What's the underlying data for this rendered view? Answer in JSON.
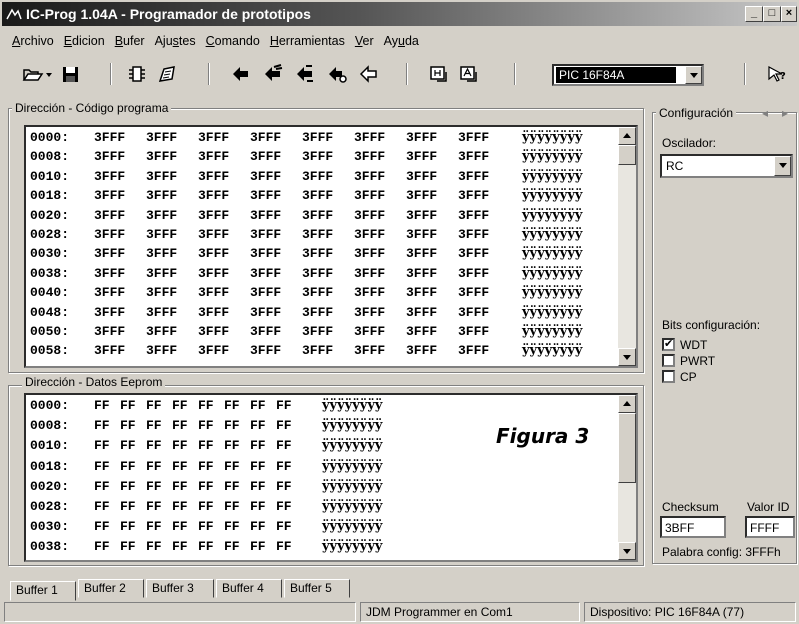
{
  "window": {
    "title": "IC-Prog 1.04A - Programador de prototipos",
    "buttons": {
      "minimize": "_",
      "maximize": "□",
      "close": "×"
    }
  },
  "menu": [
    {
      "label": "Archivo",
      "accel": "A"
    },
    {
      "label": "Edicion",
      "accel": "E"
    },
    {
      "label": "Bufer",
      "accel": "B"
    },
    {
      "label": "Ajustes",
      "accel": "s"
    },
    {
      "label": "Comando",
      "accel": "C"
    },
    {
      "label": "Herramientas",
      "accel": "H"
    },
    {
      "label": "Ver",
      "accel": "V"
    },
    {
      "label": "Ayuda",
      "accel": "u"
    }
  ],
  "toolbar": {
    "icons": [
      "open-icon",
      "dropdown-arrow-icon",
      "save-icon",
      "chip-icon",
      "chip-config-icon",
      "read-icon",
      "write-icon",
      "erase-icon",
      "verify-icon",
      "blank-check-icon",
      "view-hex-icon",
      "view-ascii-icon",
      "help-icon"
    ],
    "device": "PIC 16F84A"
  },
  "program": {
    "label": "Dirección - Código programa",
    "rows": [
      {
        "addr": "0000:",
        "words": [
          "3FFF",
          "3FFF",
          "3FFF",
          "3FFF",
          "3FFF",
          "3FFF",
          "3FFF",
          "3FFF"
        ],
        "ascii": "ÿÿÿÿÿÿÿÿ"
      },
      {
        "addr": "0008:",
        "words": [
          "3FFF",
          "3FFF",
          "3FFF",
          "3FFF",
          "3FFF",
          "3FFF",
          "3FFF",
          "3FFF"
        ],
        "ascii": "ÿÿÿÿÿÿÿÿ"
      },
      {
        "addr": "0010:",
        "words": [
          "3FFF",
          "3FFF",
          "3FFF",
          "3FFF",
          "3FFF",
          "3FFF",
          "3FFF",
          "3FFF"
        ],
        "ascii": "ÿÿÿÿÿÿÿÿ"
      },
      {
        "addr": "0018:",
        "words": [
          "3FFF",
          "3FFF",
          "3FFF",
          "3FFF",
          "3FFF",
          "3FFF",
          "3FFF",
          "3FFF"
        ],
        "ascii": "ÿÿÿÿÿÿÿÿ"
      },
      {
        "addr": "0020:",
        "words": [
          "3FFF",
          "3FFF",
          "3FFF",
          "3FFF",
          "3FFF",
          "3FFF",
          "3FFF",
          "3FFF"
        ],
        "ascii": "ÿÿÿÿÿÿÿÿ"
      },
      {
        "addr": "0028:",
        "words": [
          "3FFF",
          "3FFF",
          "3FFF",
          "3FFF",
          "3FFF",
          "3FFF",
          "3FFF",
          "3FFF"
        ],
        "ascii": "ÿÿÿÿÿÿÿÿ"
      },
      {
        "addr": "0030:",
        "words": [
          "3FFF",
          "3FFF",
          "3FFF",
          "3FFF",
          "3FFF",
          "3FFF",
          "3FFF",
          "3FFF"
        ],
        "ascii": "ÿÿÿÿÿÿÿÿ"
      },
      {
        "addr": "0038:",
        "words": [
          "3FFF",
          "3FFF",
          "3FFF",
          "3FFF",
          "3FFF",
          "3FFF",
          "3FFF",
          "3FFF"
        ],
        "ascii": "ÿÿÿÿÿÿÿÿ"
      },
      {
        "addr": "0040:",
        "words": [
          "3FFF",
          "3FFF",
          "3FFF",
          "3FFF",
          "3FFF",
          "3FFF",
          "3FFF",
          "3FFF"
        ],
        "ascii": "ÿÿÿÿÿÿÿÿ"
      },
      {
        "addr": "0048:",
        "words": [
          "3FFF",
          "3FFF",
          "3FFF",
          "3FFF",
          "3FFF",
          "3FFF",
          "3FFF",
          "3FFF"
        ],
        "ascii": "ÿÿÿÿÿÿÿÿ"
      },
      {
        "addr": "0050:",
        "words": [
          "3FFF",
          "3FFF",
          "3FFF",
          "3FFF",
          "3FFF",
          "3FFF",
          "3FFF",
          "3FFF"
        ],
        "ascii": "ÿÿÿÿÿÿÿÿ"
      },
      {
        "addr": "0058:",
        "words": [
          "3FFF",
          "3FFF",
          "3FFF",
          "3FFF",
          "3FFF",
          "3FFF",
          "3FFF",
          "3FFF"
        ],
        "ascii": "ÿÿÿÿÿÿÿÿ"
      }
    ]
  },
  "eeprom": {
    "label": "Dirección - Datos Eeprom",
    "rows": [
      {
        "addr": "0000:",
        "bytes": [
          "FF",
          "FF",
          "FF",
          "FF",
          "FF",
          "FF",
          "FF",
          "FF"
        ],
        "ascii": "ÿÿÿÿÿÿÿÿ"
      },
      {
        "addr": "0008:",
        "bytes": [
          "FF",
          "FF",
          "FF",
          "FF",
          "FF",
          "FF",
          "FF",
          "FF"
        ],
        "ascii": "ÿÿÿÿÿÿÿÿ"
      },
      {
        "addr": "0010:",
        "bytes": [
          "FF",
          "FF",
          "FF",
          "FF",
          "FF",
          "FF",
          "FF",
          "FF"
        ],
        "ascii": "ÿÿÿÿÿÿÿÿ"
      },
      {
        "addr": "0018:",
        "bytes": [
          "FF",
          "FF",
          "FF",
          "FF",
          "FF",
          "FF",
          "FF",
          "FF"
        ],
        "ascii": "ÿÿÿÿÿÿÿÿ"
      },
      {
        "addr": "0020:",
        "bytes": [
          "FF",
          "FF",
          "FF",
          "FF",
          "FF",
          "FF",
          "FF",
          "FF"
        ],
        "ascii": "ÿÿÿÿÿÿÿÿ"
      },
      {
        "addr": "0028:",
        "bytes": [
          "FF",
          "FF",
          "FF",
          "FF",
          "FF",
          "FF",
          "FF",
          "FF"
        ],
        "ascii": "ÿÿÿÿÿÿÿÿ"
      },
      {
        "addr": "0030:",
        "bytes": [
          "FF",
          "FF",
          "FF",
          "FF",
          "FF",
          "FF",
          "FF",
          "FF"
        ],
        "ascii": "ÿÿÿÿÿÿÿÿ"
      },
      {
        "addr": "0038:",
        "bytes": [
          "FF",
          "FF",
          "FF",
          "FF",
          "FF",
          "FF",
          "FF",
          "FF"
        ],
        "ascii": "ÿÿÿÿÿÿÿÿ"
      }
    ]
  },
  "figure_label": "Figura 3",
  "config": {
    "label": "Configuración",
    "nav": {
      "prev": "◂",
      "next": "▸"
    },
    "oscillator_label": "Oscilador:",
    "oscillator_value": "RC",
    "bits_label": "Bits configuración:",
    "bits": [
      {
        "label": "WDT",
        "checked": true
      },
      {
        "label": "PWRT",
        "checked": false
      },
      {
        "label": "CP",
        "checked": false
      }
    ],
    "checksum_label": "Checksum",
    "checksum_value": "3BFF",
    "id_label": "Valor ID",
    "id_value": "FFFF",
    "config_word": "Palabra config: 3FFFh"
  },
  "tabs": [
    "Buffer 1",
    "Buffer 2",
    "Buffer 3",
    "Buffer 4",
    "Buffer 5"
  ],
  "active_tab": "Buffer 1",
  "status": {
    "programmer": "JDM Programmer en Com1",
    "device": "Dispositivo: PIC 16F84A  (77)"
  }
}
